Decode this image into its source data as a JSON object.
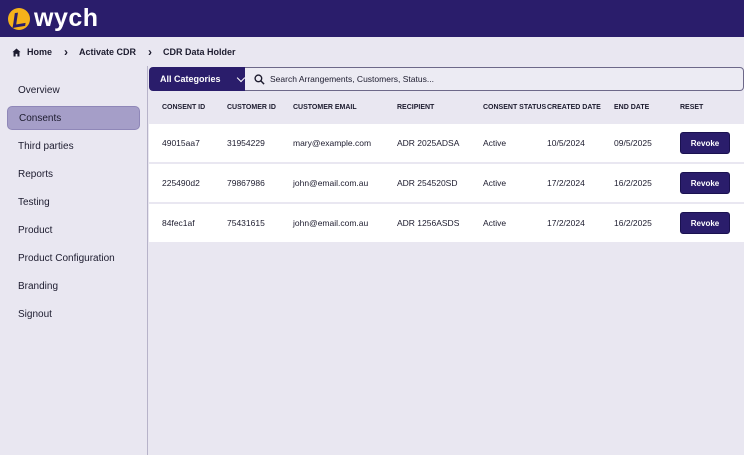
{
  "brand": {
    "name": "wych"
  },
  "breadcrumb": [
    "Home",
    "Activate CDR",
    "CDR Data Holder"
  ],
  "sidebar": {
    "items": [
      {
        "label": "Overview",
        "active": false
      },
      {
        "label": "Consents",
        "active": true
      },
      {
        "label": "Third parties",
        "active": false
      },
      {
        "label": "Reports",
        "active": false
      },
      {
        "label": "Testing",
        "active": false
      },
      {
        "label": "Product",
        "active": false
      },
      {
        "label": "Product Configuration",
        "active": false
      },
      {
        "label": "Branding",
        "active": false
      },
      {
        "label": "Signout",
        "active": false
      }
    ]
  },
  "search": {
    "category": "All Categories",
    "placeholder": "Search Arrangements, Customers, Status..."
  },
  "table": {
    "headers": [
      "CONSENT ID",
      "CUSTOMER ID",
      "CUSTOMER EMAIL",
      "RECIPIENT",
      "CONSENT STATUS",
      "CREATED DATE",
      "END DATE",
      "RESET"
    ],
    "rows": [
      [
        "49015aa7",
        "31954229",
        "mary@example.com",
        "ADR 2025ADSA",
        "Active",
        "10/5/2024",
        "09/5/2025"
      ],
      [
        "225490d2",
        "79867986",
        "john@email.com.au",
        "ADR 254520SD",
        "Active",
        "17/2/2024",
        "16/2/2025"
      ],
      [
        "84fec1af",
        "75431615",
        "john@email.com.au",
        "ADR 1256ASDS",
        "Active",
        "17/2/2024",
        "16/2/2025"
      ]
    ],
    "action_label": "Revoke"
  },
  "colors": {
    "brand": "#2a1d6b",
    "accent": "#f5b21a",
    "active_nav": "#a59ec8",
    "background": "#e9e7f1"
  }
}
